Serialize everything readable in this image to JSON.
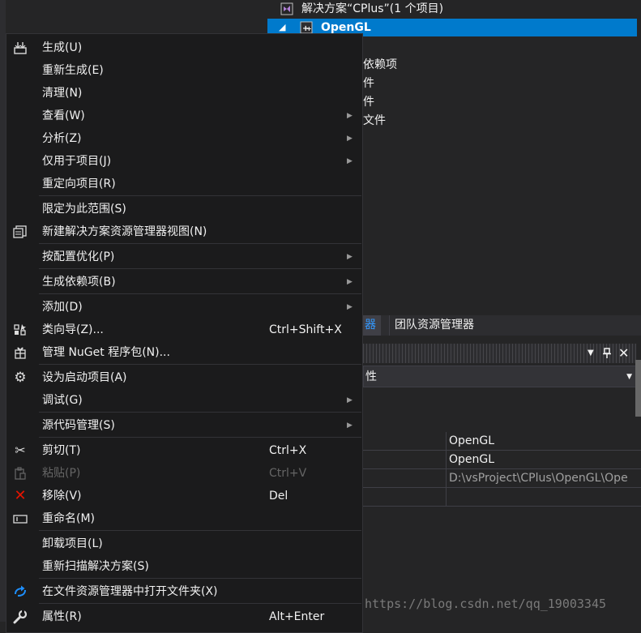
{
  "solution_explorer": {
    "solution_label": "解决方案“CPlus”(1 个项目)",
    "project_label": "OpenGL",
    "tree_items": [
      "依赖项",
      "件",
      "件",
      "文件"
    ]
  },
  "tabs": [
    {
      "label": "器",
      "active": true
    },
    {
      "label": "团队资源管理器",
      "active": false
    }
  ],
  "properties": {
    "selector_text": "性",
    "rows": [
      {
        "value": "OpenGL"
      },
      {
        "value": "OpenGL"
      },
      {
        "value": "D:\\vsProject\\CPlus\\OpenGL\\Ope"
      },
      {
        "value": ""
      }
    ]
  },
  "menu": {
    "items": [
      {
        "label": "生成(U)",
        "shortcut": "",
        "icon": "build-icon",
        "submenu": false
      },
      {
        "label": "重新生成(E)",
        "shortcut": "",
        "icon": "",
        "submenu": false
      },
      {
        "label": "清理(N)",
        "shortcut": "",
        "icon": "",
        "submenu": false
      },
      {
        "label": "查看(W)",
        "shortcut": "",
        "icon": "",
        "submenu": true
      },
      {
        "label": "分析(Z)",
        "shortcut": "",
        "icon": "",
        "submenu": true
      },
      {
        "label": "仅用于项目(J)",
        "shortcut": "",
        "icon": "",
        "submenu": true
      },
      {
        "label": "重定向项目(R)",
        "shortcut": "",
        "icon": "",
        "submenu": false
      },
      {
        "label": "限定为此范围(S)",
        "shortcut": "",
        "icon": "",
        "submenu": false
      },
      {
        "label": "新建解决方案资源管理器视图(N)",
        "shortcut": "",
        "icon": "new-view-icon",
        "submenu": false
      },
      {
        "label": "按配置优化(P)",
        "shortcut": "",
        "icon": "",
        "submenu": true
      },
      {
        "label": "生成依赖项(B)",
        "shortcut": "",
        "icon": "",
        "submenu": true
      },
      {
        "label": "添加(D)",
        "shortcut": "",
        "icon": "",
        "submenu": true
      },
      {
        "label": "类向导(Z)...",
        "shortcut": "Ctrl+Shift+X",
        "icon": "class-wizard-icon",
        "submenu": false
      },
      {
        "label": "管理 NuGet 程序包(N)...",
        "shortcut": "",
        "icon": "nuget-package-icon",
        "submenu": false
      },
      {
        "label": "设为启动项目(A)",
        "shortcut": "",
        "icon": "gear-icon",
        "submenu": false
      },
      {
        "label": "调试(G)",
        "shortcut": "",
        "icon": "",
        "submenu": true
      },
      {
        "label": "源代码管理(S)",
        "shortcut": "",
        "icon": "",
        "submenu": true
      },
      {
        "label": "剪切(T)",
        "shortcut": "Ctrl+X",
        "icon": "scissors-icon",
        "submenu": false
      },
      {
        "label": "粘贴(P)",
        "shortcut": "Ctrl+V",
        "icon": "clipboard-icon",
        "submenu": false,
        "disabled": true
      },
      {
        "label": "移除(V)",
        "shortcut": "Del",
        "icon": "remove-icon",
        "submenu": false
      },
      {
        "label": "重命名(M)",
        "shortcut": "",
        "icon": "rename-icon",
        "submenu": false
      },
      {
        "label": "卸载项目(L)",
        "shortcut": "",
        "icon": "",
        "submenu": false
      },
      {
        "label": "重新扫描解决方案(S)",
        "shortcut": "",
        "icon": "",
        "submenu": false
      },
      {
        "label": "在文件资源管理器中打开文件夹(X)",
        "shortcut": "",
        "icon": "refresh-arrow-icon",
        "submenu": false
      },
      {
        "label": "属性(R)",
        "shortcut": "Alt+Enter",
        "icon": "wrench-icon",
        "submenu": false
      }
    ]
  },
  "watermark": "https://blog.csdn.net/qq_19003345",
  "colors": {
    "accent": "#007acc",
    "menu_bg": "#1b1b1c",
    "panel_bg": "#252526",
    "remove_icon": "#e51400",
    "link_tab": "#3399ff"
  }
}
